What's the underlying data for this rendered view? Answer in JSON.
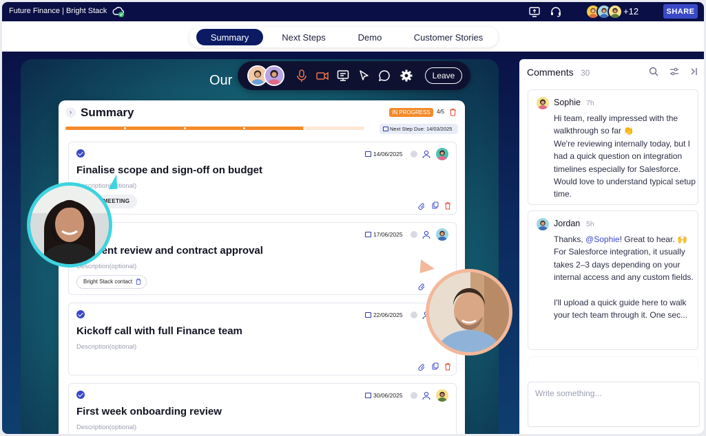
{
  "window": {
    "title": "Future Finance | Bright Stack",
    "participants_more": "+12",
    "share_label": "SHARE"
  },
  "tabs": [
    {
      "label": "Summary",
      "active": true
    },
    {
      "label": "Next Steps",
      "active": false
    },
    {
      "label": "Demo",
      "active": false
    },
    {
      "label": "Customer Stories",
      "active": false
    }
  ],
  "stage": {
    "heading_partial": "Our"
  },
  "call_toolbar": {
    "leave_label": "Leave"
  },
  "summary": {
    "title": "Summary",
    "status": "IN PROGRESS",
    "progress_count": "4/5",
    "progress_fraction": 0.8,
    "next_step_due": "Next Step Due: 14/03/2025",
    "tasks": [
      {
        "title": "Finalise scope and sign-off on budget",
        "description": "Description(optional)",
        "date": "14/06/2025",
        "tag": "ZOOM MEETING"
      },
      {
        "title": "urement review and contract approval",
        "description": "Description(optional)",
        "date": "17/06/2025",
        "tag": "Bright Stack contact"
      },
      {
        "title": "Kickoff call with full Finance team",
        "description": "Description(optional)",
        "date": "22/06/2025",
        "tag": ""
      },
      {
        "title": "First week onboarding review",
        "description": "Description(optional)",
        "date": "30/06/2025",
        "tag": ""
      }
    ]
  },
  "comments": {
    "title": "Comments",
    "count": "30",
    "items": [
      {
        "name": "Sophie",
        "time": "7h",
        "body": "Hi team, really impressed with the walkthrough so far 👏\nWe're reviewing internally today, but I had a quick question on integration timelines especially for Salesforce. Would love to understand typical setup time."
      },
      {
        "name": "Jordan",
        "time": "5h",
        "mention": "@Sophie",
        "body_after_mention": "! Great to hear. 🙌\nFor Salesforce integration, it usually takes 2–3 days depending on your internal access and any custom fields.\n\nI'll upload a quick guide here to walk your tech team through it. One sec...",
        "body_prefix": "Thanks, "
      }
    ],
    "composer_placeholder": "Write something..."
  },
  "colors": {
    "topbar": "#0a0f45",
    "accent": "#3a49c8",
    "progress": "#f58a2a",
    "active_tab": "#0b1a63"
  }
}
